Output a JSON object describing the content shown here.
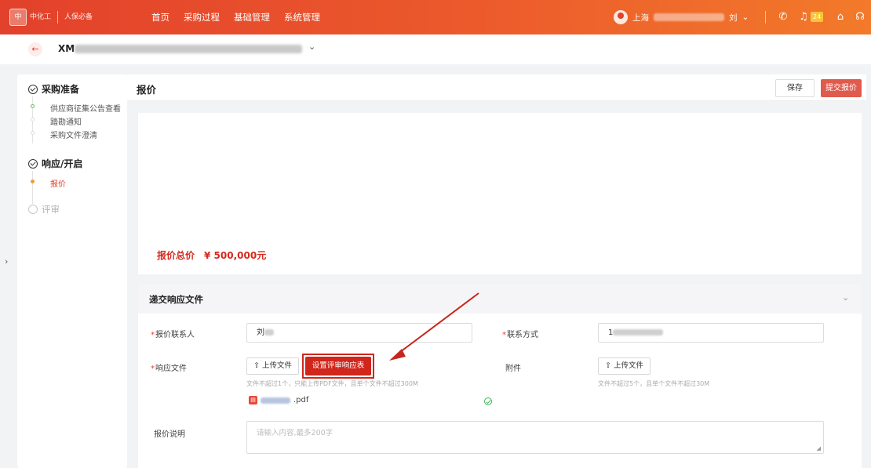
{
  "topbar": {
    "logo_badge": "中",
    "logo_text": "中化工",
    "logo_sub": "人保必备",
    "nav": [
      "首页",
      "采购过程",
      "基础管理",
      "系统管理"
    ],
    "user_prefix": "上海",
    "user_suffix": "刘",
    "notification_count": "24",
    "icons": [
      "user-icon",
      "phone-icon",
      "bell-icon",
      "home-icon",
      "headset-icon"
    ]
  },
  "project": {
    "back_icon": "arrow-left-icon",
    "code_prefix": "XM",
    "caret": "⌄"
  },
  "steps": [
    {
      "title": "采购准备",
      "status": "done",
      "items": [
        {
          "label": "供应商征集公告查看",
          "state": "done"
        },
        {
          "label": "踏勘通知",
          "state": "pending"
        },
        {
          "label": "采购文件澄清",
          "state": "pending"
        }
      ]
    },
    {
      "title": "响应/开启",
      "status": "done",
      "items": [
        {
          "label": "报价",
          "state": "active"
        }
      ]
    },
    {
      "title": "评审",
      "status": "pending",
      "items": []
    }
  ],
  "header": {
    "title": "报价",
    "save_label": "保存",
    "submit_label": "提交报价"
  },
  "price": {
    "label": "报价总价",
    "value": "¥ 500,000元"
  },
  "response": {
    "title": "递交响应文件",
    "contact_label": "报价联系人",
    "contact_value": "刘",
    "phone_label": "联系方式",
    "phone_value": "1",
    "file_label": "响应文件",
    "upload_label": "上传文件",
    "setup_button": "设置评审响应表",
    "file_hint": "文件不超过1个，只能上传PDF文件，且单个文件不超过300M",
    "file_ext": ".pdf",
    "attach_label": "附件",
    "attach_upload": "上传文件",
    "attach_hint": "文件不超过5个，且单个文件不超过30M",
    "remark_label": "报价说明",
    "remark_placeholder": "请输入内容,最多200字"
  },
  "colors": {
    "accent": "#e2412b",
    "button_red": "#d0261c",
    "annotation": "#c8261d"
  }
}
